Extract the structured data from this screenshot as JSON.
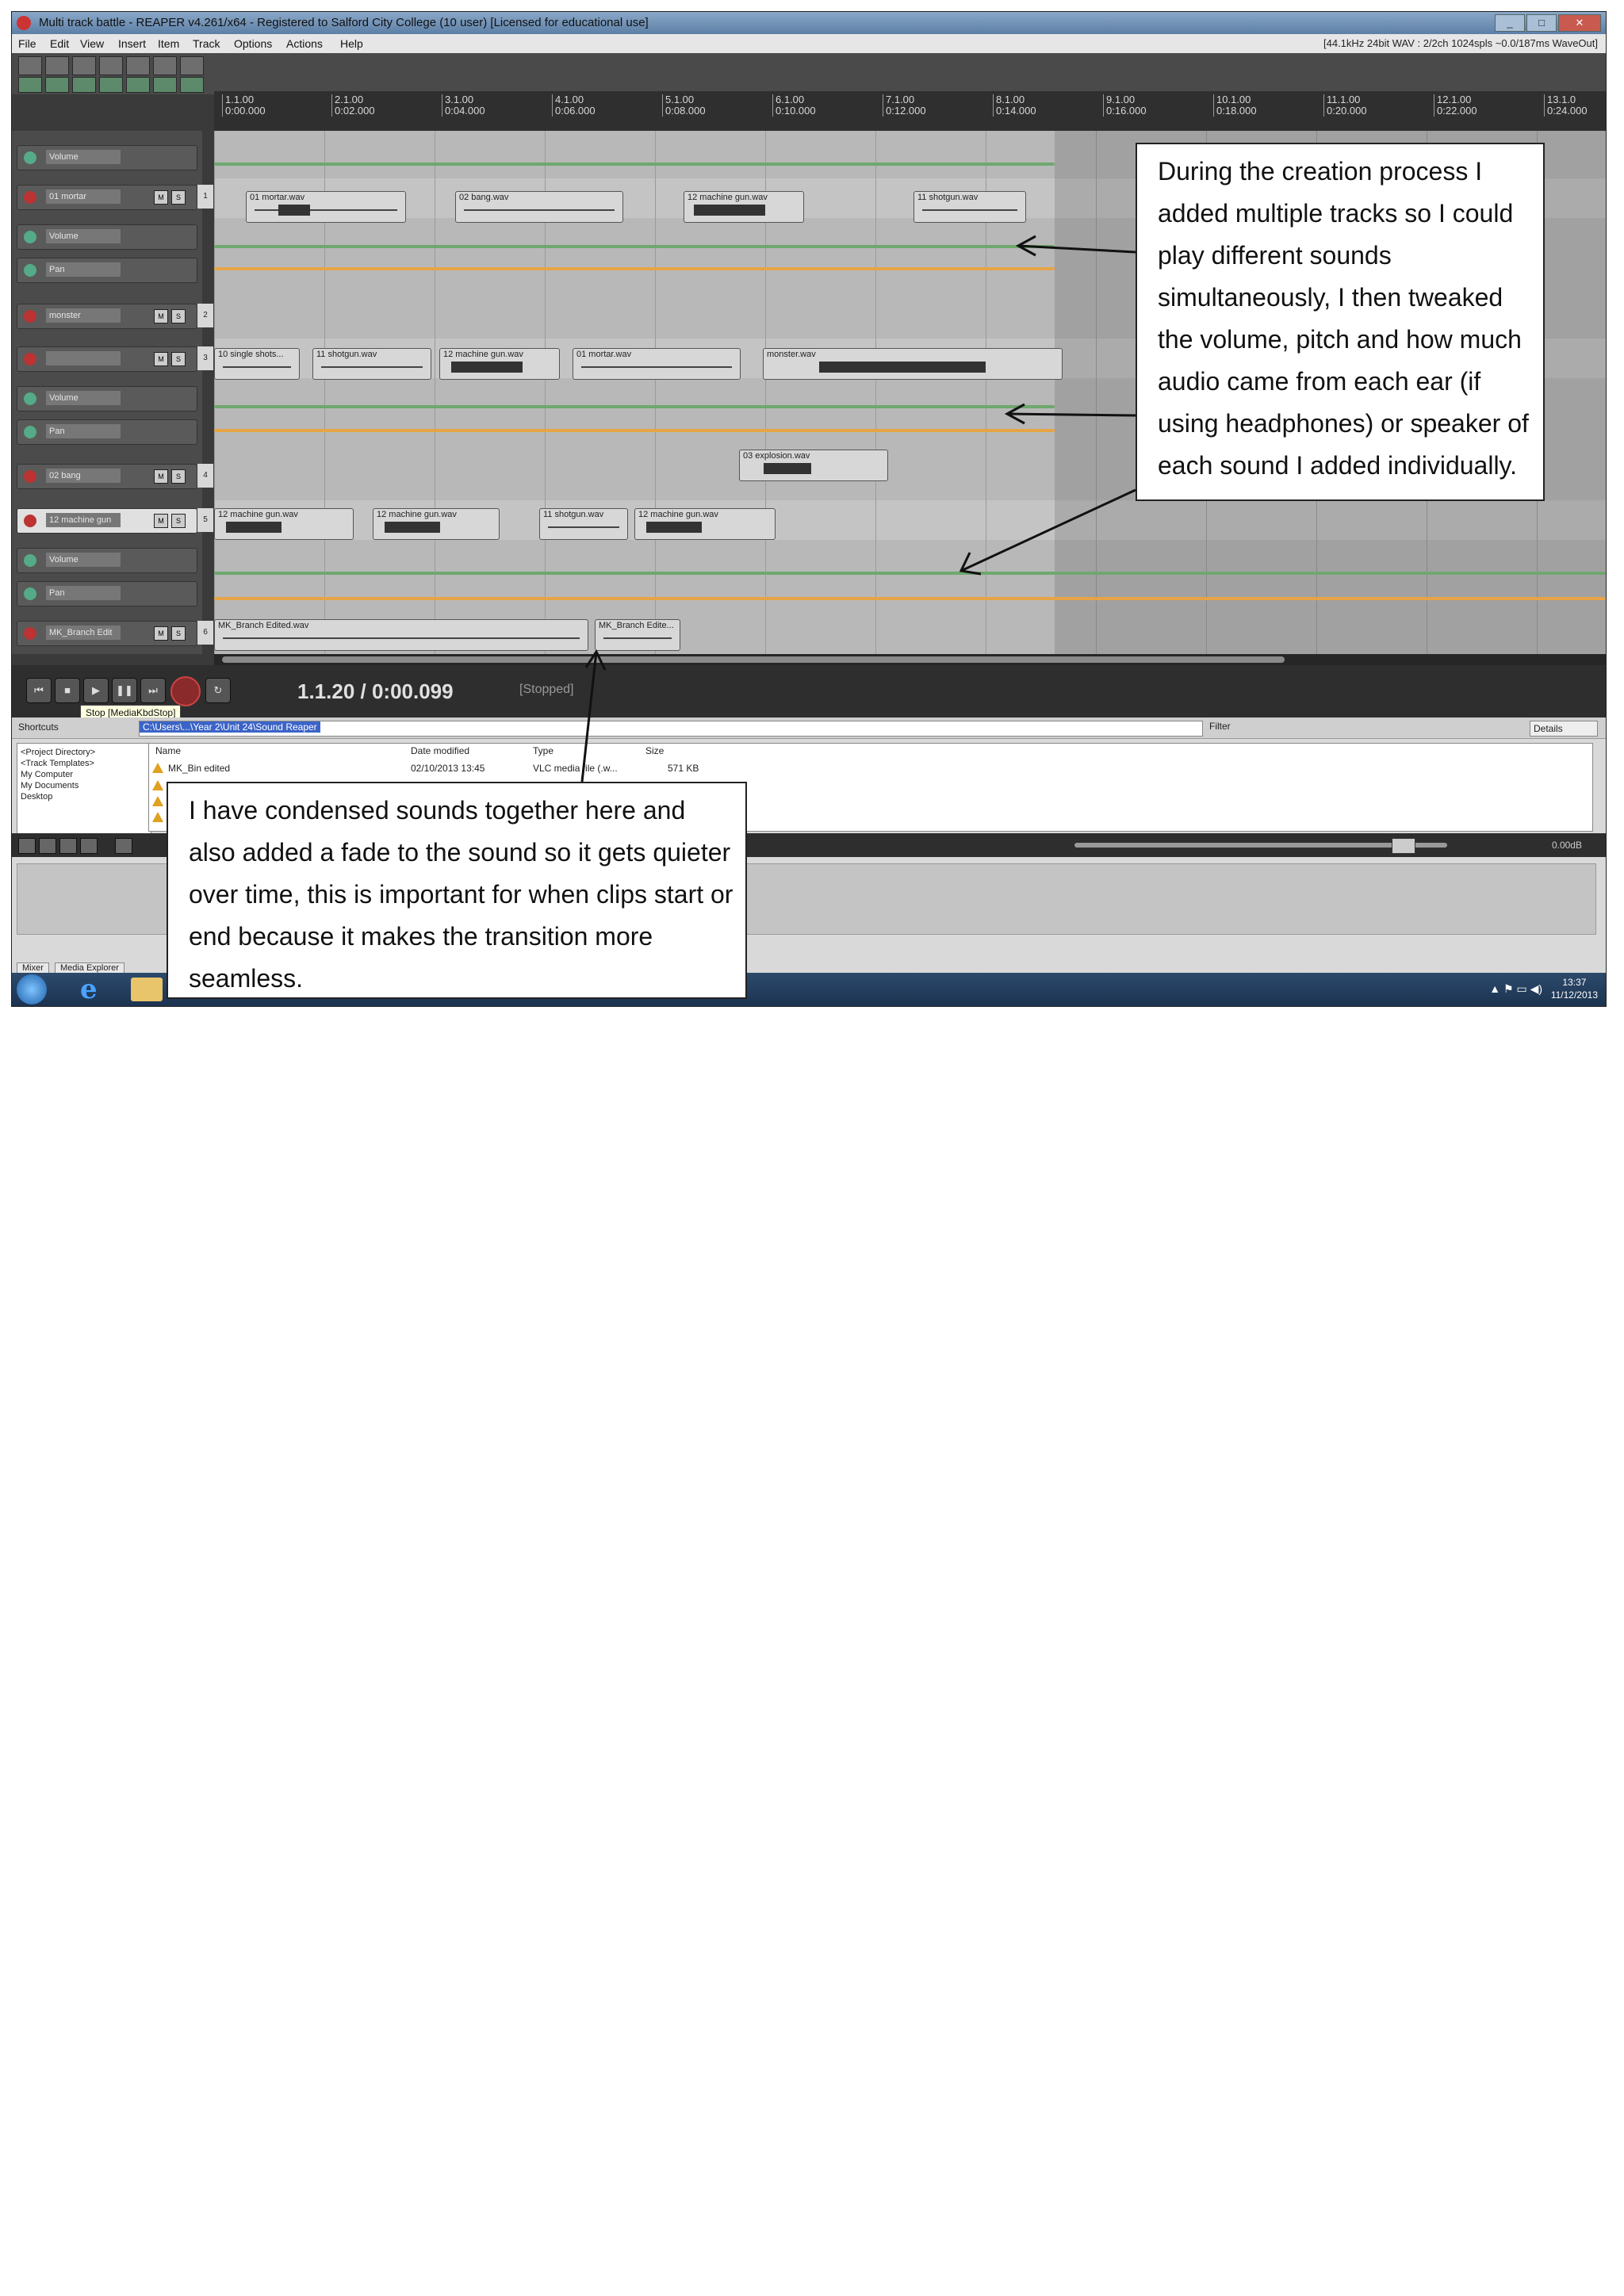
{
  "window": {
    "title": "Multi track battle - REAPER v4.261/x64 - Registered to Salford City College (10 user) [Licensed for educational use]",
    "status": "[44.1kHz 24bit WAV : 2/2ch 1024spls ~0.0/187ms WaveOut]"
  },
  "menu": [
    "File",
    "Edit",
    "View",
    "Insert",
    "Item",
    "Track",
    "Options",
    "Actions",
    "Help"
  ],
  "ruler": [
    {
      "bar": "1.1.00",
      "time": "0:00.000"
    },
    {
      "bar": "2.1.00",
      "time": "0:02.000"
    },
    {
      "bar": "3.1.00",
      "time": "0:04.000"
    },
    {
      "bar": "4.1.00",
      "time": "0:06.000"
    },
    {
      "bar": "5.1.00",
      "time": "0:08.000"
    },
    {
      "bar": "6.1.00",
      "time": "0:10.000"
    },
    {
      "bar": "7.1.00",
      "time": "0:12.000"
    },
    {
      "bar": "8.1.00",
      "time": "0:14.000"
    },
    {
      "bar": "9.1.00",
      "time": "0:16.000"
    },
    {
      "bar": "10.1.00",
      "time": "0:18.000"
    },
    {
      "bar": "11.1.00",
      "time": "0:20.000"
    },
    {
      "bar": "12.1.00",
      "time": "0:22.000"
    },
    {
      "bar": "13.1.0",
      "time": "0:24.000"
    }
  ],
  "tracks": [
    {
      "name": "Volume",
      "num": ""
    },
    {
      "name": "01 mortar",
      "num": "1"
    },
    {
      "name": "Volume",
      "num": ""
    },
    {
      "name": "Pan",
      "num": ""
    },
    {
      "name": "monster",
      "num": "2"
    },
    {
      "name": "",
      "num": "3"
    },
    {
      "name": "Volume",
      "num": ""
    },
    {
      "name": "Pan",
      "num": ""
    },
    {
      "name": "02 bang",
      "num": "4"
    },
    {
      "name": "12 machine gun",
      "num": "5"
    },
    {
      "name": "Volume",
      "num": ""
    },
    {
      "name": "Pan",
      "num": ""
    },
    {
      "name": "MK_Branch Edit",
      "num": "6"
    }
  ],
  "clips": [
    "01 mortar.wav",
    "02 bang.wav",
    "12 machine gun.wav",
    "11 shotgun.wav",
    "10 single shots...",
    "11 shotgun.wav",
    "12 machine gun.wav",
    "01 mortar.wav",
    "monster.wav",
    "03 explosion.wav",
    "12 machine gun.wav",
    "12 machine gun.wav",
    "11 shotgun.wav",
    "12 machine gun.wav",
    "MK_Branch Edited.wav",
    "MK_Branch Edite..."
  ],
  "transport": {
    "position": "1.1.20 / 0:00.099",
    "state": "[Stopped]",
    "tooltip": "Stop [MediaKbdStop]"
  },
  "explorer": {
    "shortcuts_label": "Shortcuts",
    "path": "C:\\Users\\...\\Year 2\\Unit 24\\Sound Reaper",
    "filter_label": "Filter",
    "view": "Details",
    "left_items": [
      "<Project Directory>",
      "<Track Templates>",
      "My Computer",
      "My Documents",
      "Desktop"
    ],
    "columns": [
      "Name",
      "Date modified",
      "Type",
      "Size"
    ],
    "row": {
      "name": "MK_Bin edited",
      "date": "02/10/2013 13:45",
      "type": "VLC media file (.w...",
      "size": "571 KB"
    },
    "volume_db": "0.00dB",
    "tabs": [
      "Mixer",
      "Media Explorer"
    ]
  },
  "taskbar": {
    "time": "13:37",
    "date": "11/12/2013"
  },
  "callouts": {
    "top_right": "During the creation process I added multiple tracks so I could play different sounds simultaneously, I then tweaked the volume, pitch and how much audio came from each ear (if using headphones) or speaker of each sound I added individually.",
    "bottom": "I have condensed sounds together here and also added a fade to the sound so it gets quieter over time, this is important for when clips start or end because it makes the transition more seamless."
  },
  "colors": {
    "volume_envelope": "#6fa86f",
    "pan_envelope": "#e7a446",
    "record": "#b33333",
    "selection": "#3b64c8"
  }
}
